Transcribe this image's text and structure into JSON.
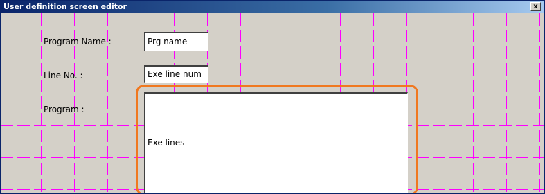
{
  "window": {
    "title": "User definition screen editor",
    "close_label": "x"
  },
  "form": {
    "program_name_label": "Program Name :",
    "program_name_value": "Prg name",
    "line_no_label": "Line No. :",
    "line_no_value": "Exe line num",
    "program_label": "Program :",
    "program_value": "Exe lines"
  },
  "colors": {
    "grid_line": "#ff00ff",
    "highlight": "#f07820",
    "background": "#d4d0c8"
  }
}
